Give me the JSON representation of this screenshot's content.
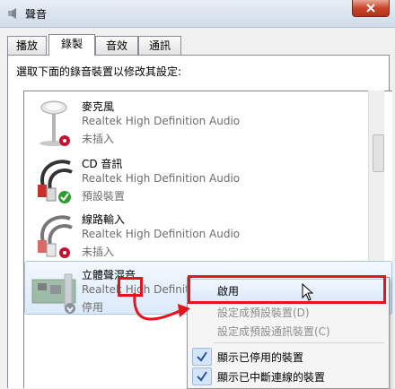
{
  "window": {
    "title": "聲音"
  },
  "tabs": [
    {
      "label": "播放",
      "active": false
    },
    {
      "label": "錄製",
      "active": true
    },
    {
      "label": "音效",
      "active": false
    },
    {
      "label": "通訊",
      "active": false
    }
  ],
  "instruction": "選取下面的錄音裝置以修改其設定:",
  "devices": [
    {
      "name": "麥克風",
      "driver": "Realtek High Definition Audio",
      "status": "未插入",
      "icon": "microphone-icon",
      "badge": "unplugged-badge"
    },
    {
      "name": "CD 音訊",
      "driver": "Realtek High Definition Audio",
      "status": "預設裝置",
      "icon": "rca-cable-icon",
      "badge": "default-check-badge"
    },
    {
      "name": "線路輸入",
      "driver": "Realtek High Definition Audio",
      "status": "未插入",
      "icon": "line-in-cable-icon",
      "badge": "unplugged-badge"
    },
    {
      "name": "立體聲混音",
      "driver": "Realtek High Definiti",
      "status": "停用",
      "icon": "sound-card-icon",
      "badge": "disabled-badge"
    }
  ],
  "context_menu": {
    "items": [
      {
        "label": "啟用",
        "enabled": true,
        "highlighted": true
      },
      {
        "label": "設定成預設裝置(D)",
        "enabled": false
      },
      {
        "label": "設定成預設通訊裝置(C)",
        "enabled": false
      },
      {
        "label": "顯示已停用的裝置",
        "checked": true
      },
      {
        "label": "顯示已中斷連線的裝置",
        "checked": true
      }
    ]
  },
  "colors": {
    "annotation_red": "#e3141c",
    "selection_blue": "#dbeafa"
  }
}
